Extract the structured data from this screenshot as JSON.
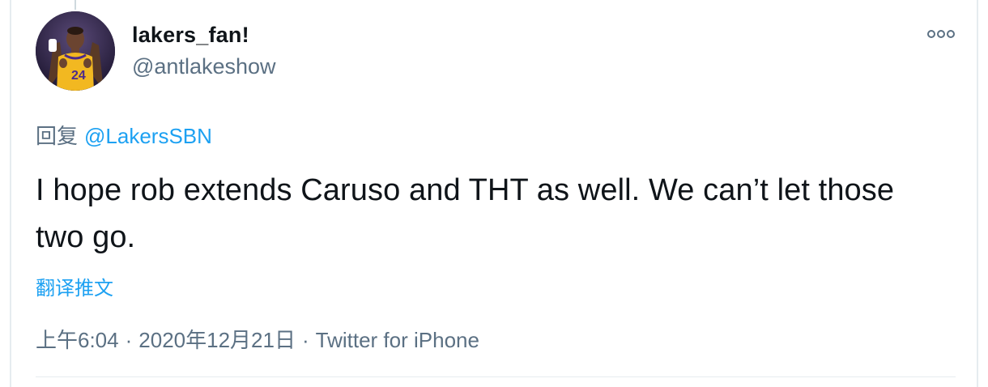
{
  "tweet": {
    "display_name": "lakers_fan!",
    "handle": "@antlakeshow",
    "reply_prefix": "回复",
    "reply_to": "@LakersSBN",
    "text": "I hope rob extends Caruso and THT as well. We can’t let those two go.",
    "translate_label": "翻译推文",
    "time": "上午6:04",
    "date": "2020年12月21日",
    "separator": "·",
    "source": "Twitter for iPhone"
  },
  "icons": {
    "more": "more-options-icon",
    "avatar": "avatar-image"
  },
  "colors": {
    "link": "#1da1f2",
    "secondary_text": "#5b7083",
    "primary_text": "#0f1419",
    "avatar_jersey": "#f2b821"
  }
}
